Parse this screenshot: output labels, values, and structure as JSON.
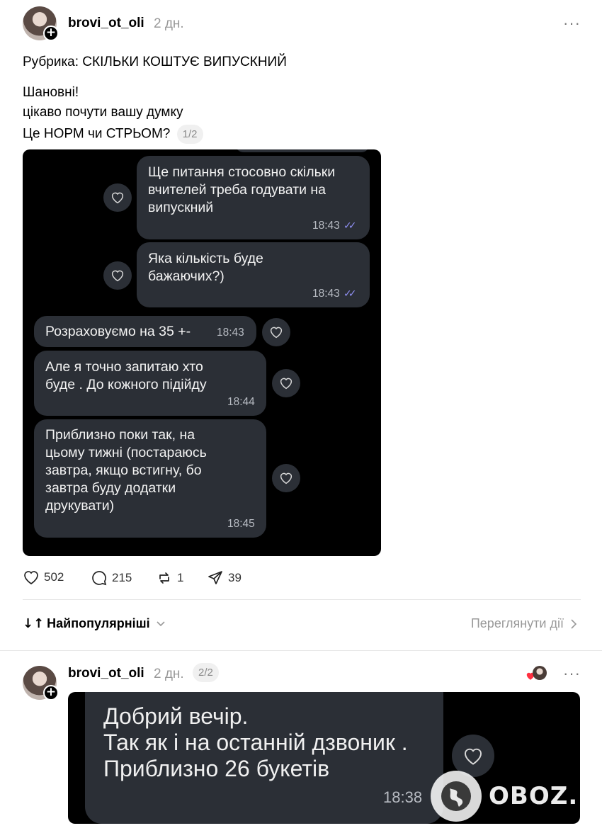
{
  "post1": {
    "username": "brovi_ot_oli",
    "time": "2 дн.",
    "more": "···",
    "lines": [
      "Рубрика: СКІЛЬКИ КОШТУЄ ВИПУСКНИЙ",
      "Шановні!",
      "цікаво почути вашу думку",
      "Це НОРМ чи СТРЬОМ?"
    ],
    "pager": "1/2",
    "chat": [
      {
        "text": "Ще питання стосовно скільки\nвчителей треба годувати на\nвипускний",
        "time": "18:43",
        "side": "out"
      },
      {
        "text": "Яка кількість буде\nбажаючих?)",
        "time": "18:43",
        "side": "out"
      },
      {
        "text": "Розраховуємо на 35 +-",
        "time": "18:43",
        "side": "in"
      },
      {
        "text": "Але я точно запитаю хто\nбуде . До кожного підійду",
        "time": "18:44",
        "side": "in"
      },
      {
        "text": "Приблизно поки так, на\nцьому тижні (постараюсь\nзавтра, якщо встигну, бо\nзавтра буду додатки\nдрукувати)",
        "time": "18:45",
        "side": "in"
      }
    ],
    "stats": {
      "likes": "502",
      "comments": "215",
      "reposts": "1",
      "shares": "39"
    }
  },
  "sort": {
    "label": "Найпопулярніші",
    "view_activity": "Переглянути дії"
  },
  "post2": {
    "username": "brovi_ot_oli",
    "time": "2 дн.",
    "pager": "2/2",
    "more": "···",
    "chat_text": "Добрий вечір.\nТак як і на останній дзвоник .\nПриблизно 26 букетів",
    "chat_time": "18:38"
  },
  "watermark": "OBOZ.UA",
  "colors": {
    "bubble": "#2b2f36",
    "check": "#8f8ff2",
    "muted": "#999999",
    "heart_red": "#ff3040"
  }
}
